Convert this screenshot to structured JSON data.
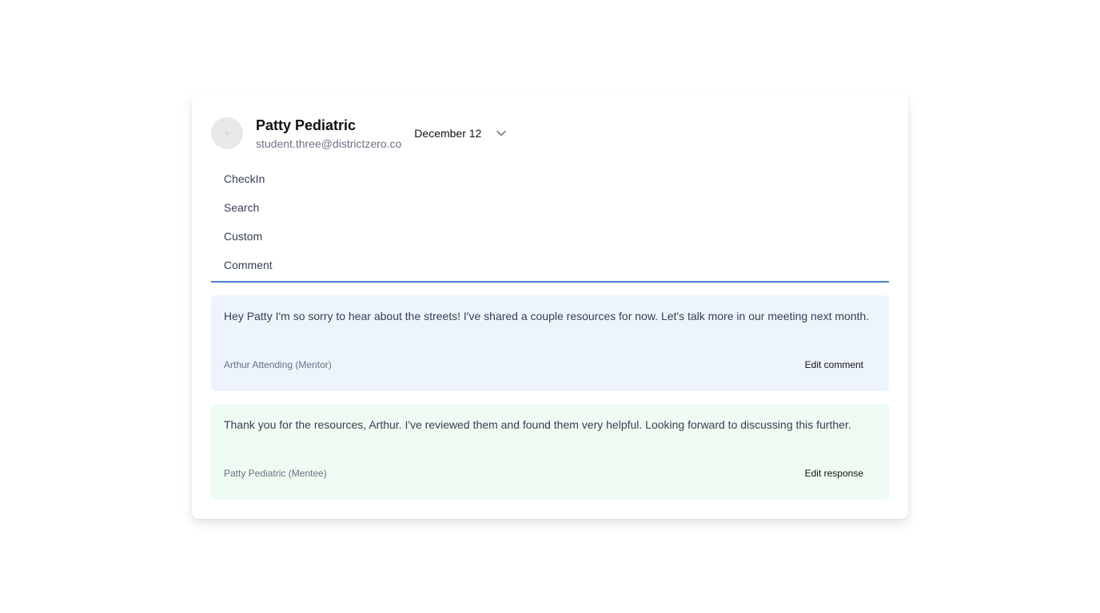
{
  "profile": {
    "name": "Patty Pediatric",
    "email": "student.three@districtzero.co",
    "avatar_icon": "avatar-placeholder"
  },
  "date_select": {
    "value": "December 12",
    "icon": "chevron-down-icon"
  },
  "menu": {
    "items": [
      {
        "label": "CheckIn"
      },
      {
        "label": "Search"
      },
      {
        "label": "Custom"
      },
      {
        "label": "Comment"
      }
    ],
    "active": "Comment",
    "accent_color": "#4a7fd0"
  },
  "comments": [
    {
      "text": "Hey Patty I'm so sorry to hear about the streets! I've shared a couple resources for now. Let's talk more in our meeting next month.",
      "author": "Arthur Attending (Mentor)",
      "action_label": "Edit comment",
      "background": "#eef4fd"
    },
    {
      "text": "Thank you for the resources, Arthur. I've reviewed them and found them very helpful. Looking forward to discussing this further.",
      "author": "Patty Pediatric (Mentee)",
      "action_label": "Edit response",
      "background": "#eefbf3"
    }
  ]
}
